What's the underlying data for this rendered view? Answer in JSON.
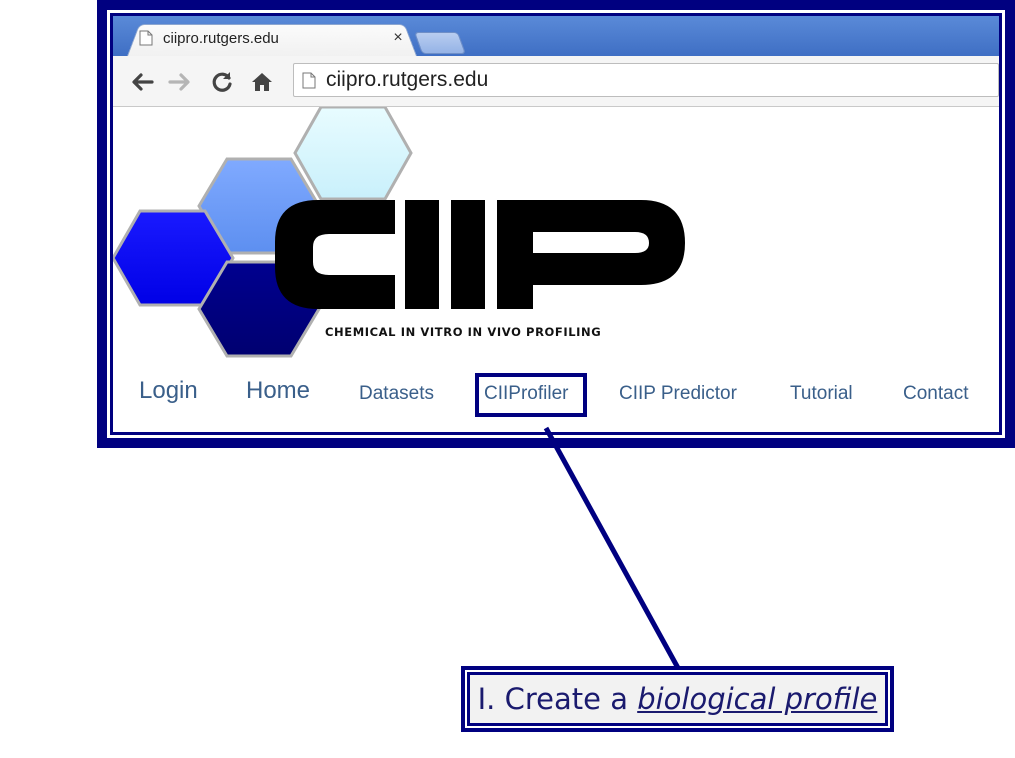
{
  "browser": {
    "tab": {
      "title": "ciipro.rutgers.edu",
      "close_glyph": "×",
      "icon": "page-icon"
    },
    "new_tab_icon": "new-tab-icon",
    "toolbar": {
      "back_icon": "back-arrow-icon",
      "forward_icon": "forward-arrow-icon",
      "reload_icon": "reload-icon",
      "home_icon": "home-icon",
      "url": "ciipro.rutgers.edu"
    }
  },
  "site": {
    "logo": {
      "wordmark": "CIIP",
      "tagline": "CHEMICAL IN VITRO IN VIVO PROFILING"
    },
    "nav": [
      {
        "label": "Login"
      },
      {
        "label": "Home"
      },
      {
        "label": "Datasets"
      },
      {
        "label": "CIIProfiler"
      },
      {
        "label": "CIIP Predictor"
      },
      {
        "label": "Tutorial"
      },
      {
        "label": "Contact"
      }
    ],
    "highlighted_nav": "CIIProfiler"
  },
  "callout": {
    "prefix": "I. Create a ",
    "emphasis": "biological profile"
  },
  "colors": {
    "frame": "#000080",
    "nav_text": "#3a5f8a",
    "hex_blue": "#0000ff",
    "hex_mid": "#6fa0ff",
    "hex_light": "#d8f8ff",
    "hex_navy": "#000080"
  }
}
